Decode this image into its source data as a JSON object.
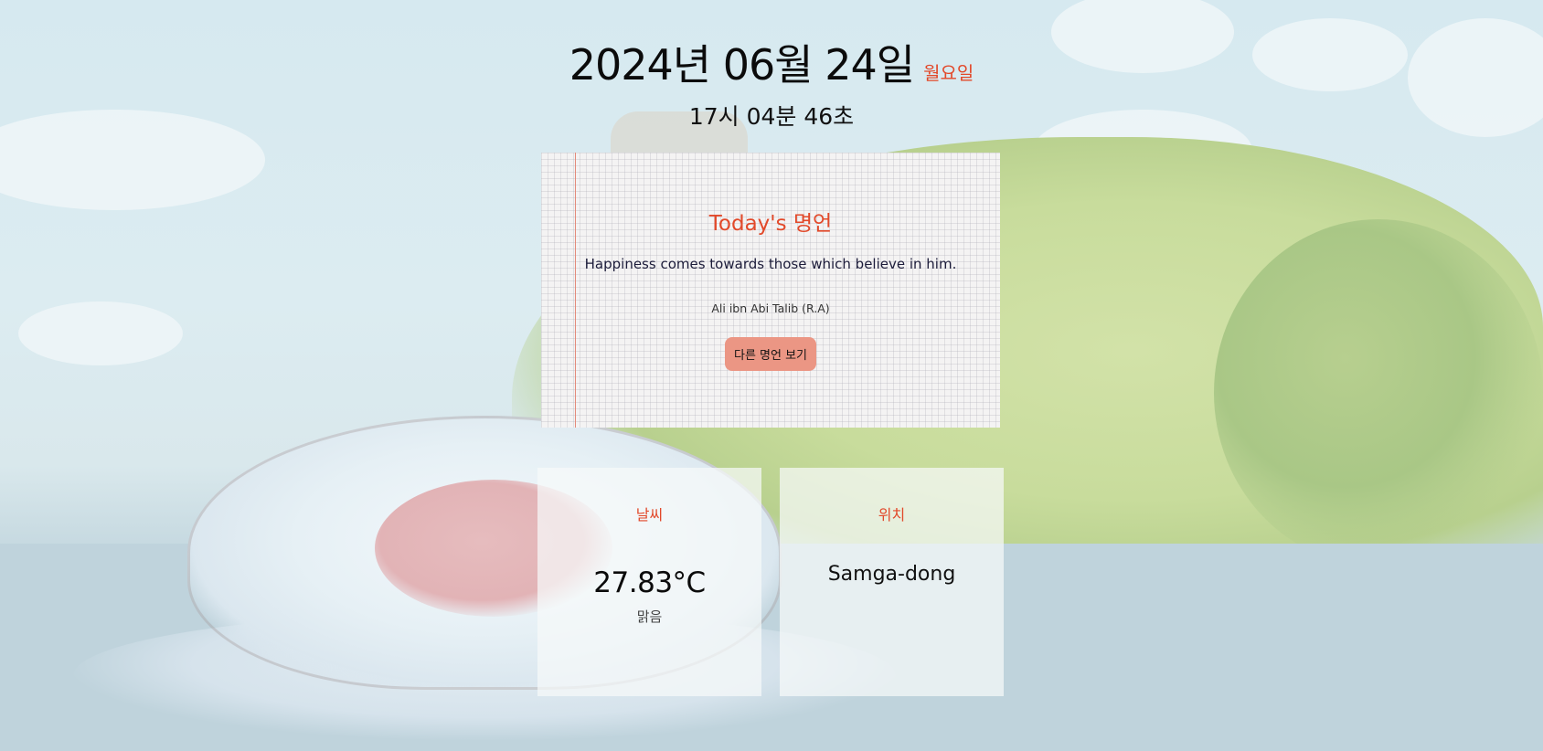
{
  "clock": {
    "date": "2024년 06월 24일",
    "weekday": "월요일",
    "time": "17시 04분 46초"
  },
  "quote": {
    "title": "Today's 명언",
    "text": "Happiness comes towards those which believe in him.",
    "author": "Ali ibn Abi Talib (R.A)",
    "button_label": "다른 명언 보기"
  },
  "weather": {
    "label": "날씨",
    "temperature": "27.83°C",
    "condition": "맑음"
  },
  "location": {
    "label": "위치",
    "place": "Samga-dong"
  },
  "colors": {
    "accent": "#e2492a",
    "button": "#eb9684",
    "quote_text": "#1c1c3a"
  }
}
